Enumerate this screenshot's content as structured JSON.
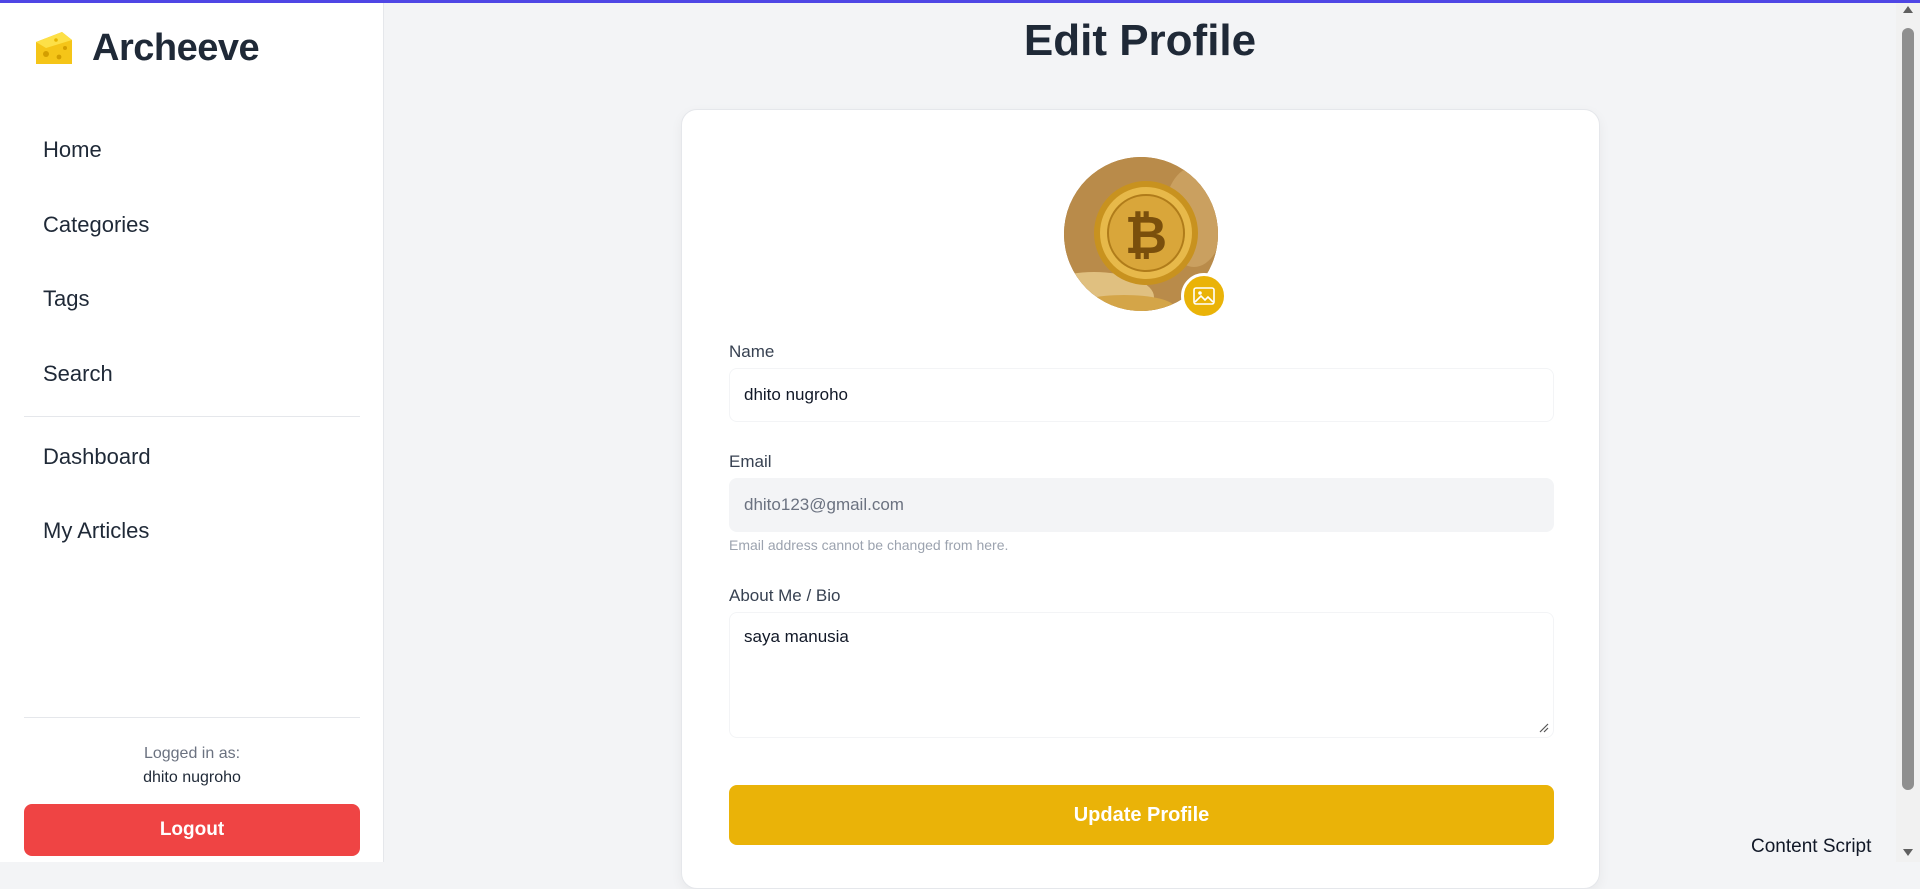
{
  "colors": {
    "accent": "#eab308",
    "danger": "#ef4444",
    "top_line": "#4f46e5"
  },
  "brand": {
    "name": "Archeeve",
    "logo_icon": "cheese-icon"
  },
  "nav": {
    "items": [
      {
        "label": "Home"
      },
      {
        "label": "Categories"
      },
      {
        "label": "Tags"
      },
      {
        "label": "Search"
      }
    ],
    "user_items": [
      {
        "label": "Dashboard"
      },
      {
        "label": "My Articles"
      }
    ]
  },
  "session": {
    "logged_in_label": "Logged in as:",
    "user_name": "dhito nugroho",
    "logout_label": "Logout"
  },
  "page": {
    "title": "Edit Profile"
  },
  "form": {
    "avatar_icon": "bitcoin-avatar",
    "change_photo_icon": "image-icon",
    "name_label": "Name",
    "name_value": "dhito nugroho",
    "email_label": "Email",
    "email_value": "dhito123@gmail.com",
    "email_hint": "Email address cannot be changed from here.",
    "bio_label": "About Me / Bio",
    "bio_value": "saya manusia",
    "submit_label": "Update Profile"
  },
  "overlay": {
    "content_script": "Content Script"
  }
}
